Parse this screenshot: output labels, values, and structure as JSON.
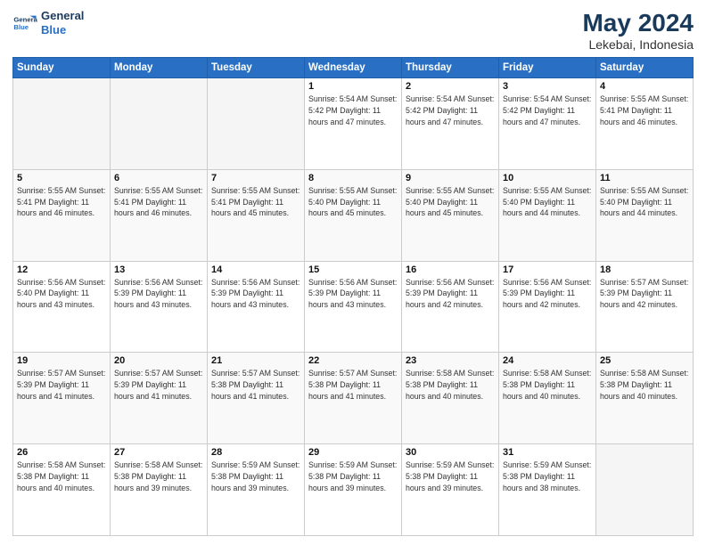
{
  "header": {
    "logo_line1": "General",
    "logo_line2": "Blue",
    "title": "May 2024",
    "subtitle": "Lekebai, Indonesia"
  },
  "days_of_week": [
    "Sunday",
    "Monday",
    "Tuesday",
    "Wednesday",
    "Thursday",
    "Friday",
    "Saturday"
  ],
  "weeks": [
    [
      {
        "day": "",
        "info": ""
      },
      {
        "day": "",
        "info": ""
      },
      {
        "day": "",
        "info": ""
      },
      {
        "day": "1",
        "info": "Sunrise: 5:54 AM\nSunset: 5:42 PM\nDaylight: 11 hours\nand 47 minutes."
      },
      {
        "day": "2",
        "info": "Sunrise: 5:54 AM\nSunset: 5:42 PM\nDaylight: 11 hours\nand 47 minutes."
      },
      {
        "day": "3",
        "info": "Sunrise: 5:54 AM\nSunset: 5:42 PM\nDaylight: 11 hours\nand 47 minutes."
      },
      {
        "day": "4",
        "info": "Sunrise: 5:55 AM\nSunset: 5:41 PM\nDaylight: 11 hours\nand 46 minutes."
      }
    ],
    [
      {
        "day": "5",
        "info": "Sunrise: 5:55 AM\nSunset: 5:41 PM\nDaylight: 11 hours\nand 46 minutes."
      },
      {
        "day": "6",
        "info": "Sunrise: 5:55 AM\nSunset: 5:41 PM\nDaylight: 11 hours\nand 46 minutes."
      },
      {
        "day": "7",
        "info": "Sunrise: 5:55 AM\nSunset: 5:41 PM\nDaylight: 11 hours\nand 45 minutes."
      },
      {
        "day": "8",
        "info": "Sunrise: 5:55 AM\nSunset: 5:40 PM\nDaylight: 11 hours\nand 45 minutes."
      },
      {
        "day": "9",
        "info": "Sunrise: 5:55 AM\nSunset: 5:40 PM\nDaylight: 11 hours\nand 45 minutes."
      },
      {
        "day": "10",
        "info": "Sunrise: 5:55 AM\nSunset: 5:40 PM\nDaylight: 11 hours\nand 44 minutes."
      },
      {
        "day": "11",
        "info": "Sunrise: 5:55 AM\nSunset: 5:40 PM\nDaylight: 11 hours\nand 44 minutes."
      }
    ],
    [
      {
        "day": "12",
        "info": "Sunrise: 5:56 AM\nSunset: 5:40 PM\nDaylight: 11 hours\nand 43 minutes."
      },
      {
        "day": "13",
        "info": "Sunrise: 5:56 AM\nSunset: 5:39 PM\nDaylight: 11 hours\nand 43 minutes."
      },
      {
        "day": "14",
        "info": "Sunrise: 5:56 AM\nSunset: 5:39 PM\nDaylight: 11 hours\nand 43 minutes."
      },
      {
        "day": "15",
        "info": "Sunrise: 5:56 AM\nSunset: 5:39 PM\nDaylight: 11 hours\nand 43 minutes."
      },
      {
        "day": "16",
        "info": "Sunrise: 5:56 AM\nSunset: 5:39 PM\nDaylight: 11 hours\nand 42 minutes."
      },
      {
        "day": "17",
        "info": "Sunrise: 5:56 AM\nSunset: 5:39 PM\nDaylight: 11 hours\nand 42 minutes."
      },
      {
        "day": "18",
        "info": "Sunrise: 5:57 AM\nSunset: 5:39 PM\nDaylight: 11 hours\nand 42 minutes."
      }
    ],
    [
      {
        "day": "19",
        "info": "Sunrise: 5:57 AM\nSunset: 5:39 PM\nDaylight: 11 hours\nand 41 minutes."
      },
      {
        "day": "20",
        "info": "Sunrise: 5:57 AM\nSunset: 5:39 PM\nDaylight: 11 hours\nand 41 minutes."
      },
      {
        "day": "21",
        "info": "Sunrise: 5:57 AM\nSunset: 5:38 PM\nDaylight: 11 hours\nand 41 minutes."
      },
      {
        "day": "22",
        "info": "Sunrise: 5:57 AM\nSunset: 5:38 PM\nDaylight: 11 hours\nand 41 minutes."
      },
      {
        "day": "23",
        "info": "Sunrise: 5:58 AM\nSunset: 5:38 PM\nDaylight: 11 hours\nand 40 minutes."
      },
      {
        "day": "24",
        "info": "Sunrise: 5:58 AM\nSunset: 5:38 PM\nDaylight: 11 hours\nand 40 minutes."
      },
      {
        "day": "25",
        "info": "Sunrise: 5:58 AM\nSunset: 5:38 PM\nDaylight: 11 hours\nand 40 minutes."
      }
    ],
    [
      {
        "day": "26",
        "info": "Sunrise: 5:58 AM\nSunset: 5:38 PM\nDaylight: 11 hours\nand 40 minutes."
      },
      {
        "day": "27",
        "info": "Sunrise: 5:58 AM\nSunset: 5:38 PM\nDaylight: 11 hours\nand 39 minutes."
      },
      {
        "day": "28",
        "info": "Sunrise: 5:59 AM\nSunset: 5:38 PM\nDaylight: 11 hours\nand 39 minutes."
      },
      {
        "day": "29",
        "info": "Sunrise: 5:59 AM\nSunset: 5:38 PM\nDaylight: 11 hours\nand 39 minutes."
      },
      {
        "day": "30",
        "info": "Sunrise: 5:59 AM\nSunset: 5:38 PM\nDaylight: 11 hours\nand 39 minutes."
      },
      {
        "day": "31",
        "info": "Sunrise: 5:59 AM\nSunset: 5:38 PM\nDaylight: 11 hours\nand 38 minutes."
      },
      {
        "day": "",
        "info": ""
      }
    ]
  ]
}
